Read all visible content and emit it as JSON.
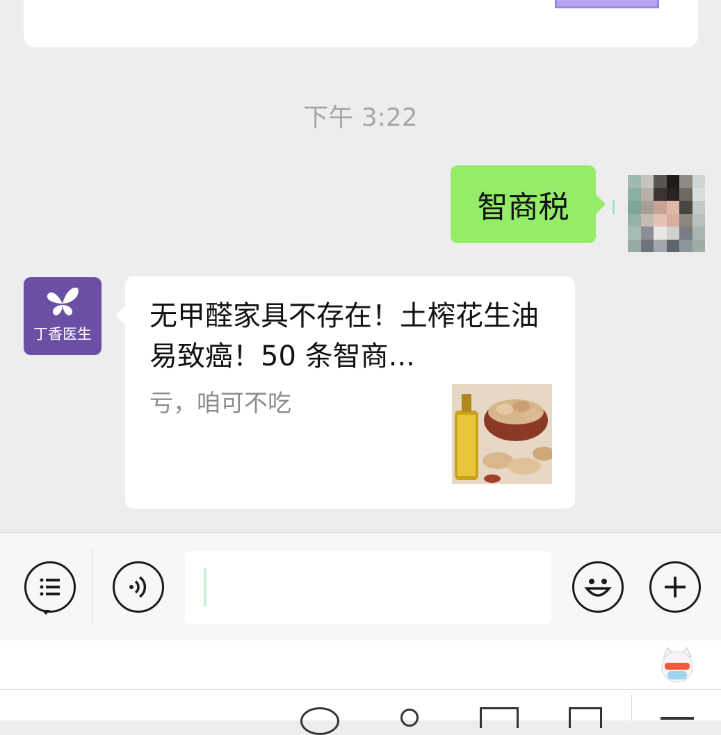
{
  "chat": {
    "timestamp": "下午 3:22",
    "sent_message": "智商税",
    "article_card": {
      "source_name": "丁香医生",
      "title": "无甲醛家具不存在！土榨花生油易致癌！50 条智商...",
      "description": "亏，咱可不吃"
    }
  },
  "input_bar": {
    "text_value": ""
  },
  "colors": {
    "background": "#ededed",
    "sent_bubble": "#95ec69",
    "bot_avatar": "#6b4fa4",
    "secondary_text": "#8c8c8c"
  },
  "icons": {
    "menu": "list-icon",
    "voice": "voice-icon",
    "emoji": "smiley-icon",
    "more": "plus-icon"
  }
}
